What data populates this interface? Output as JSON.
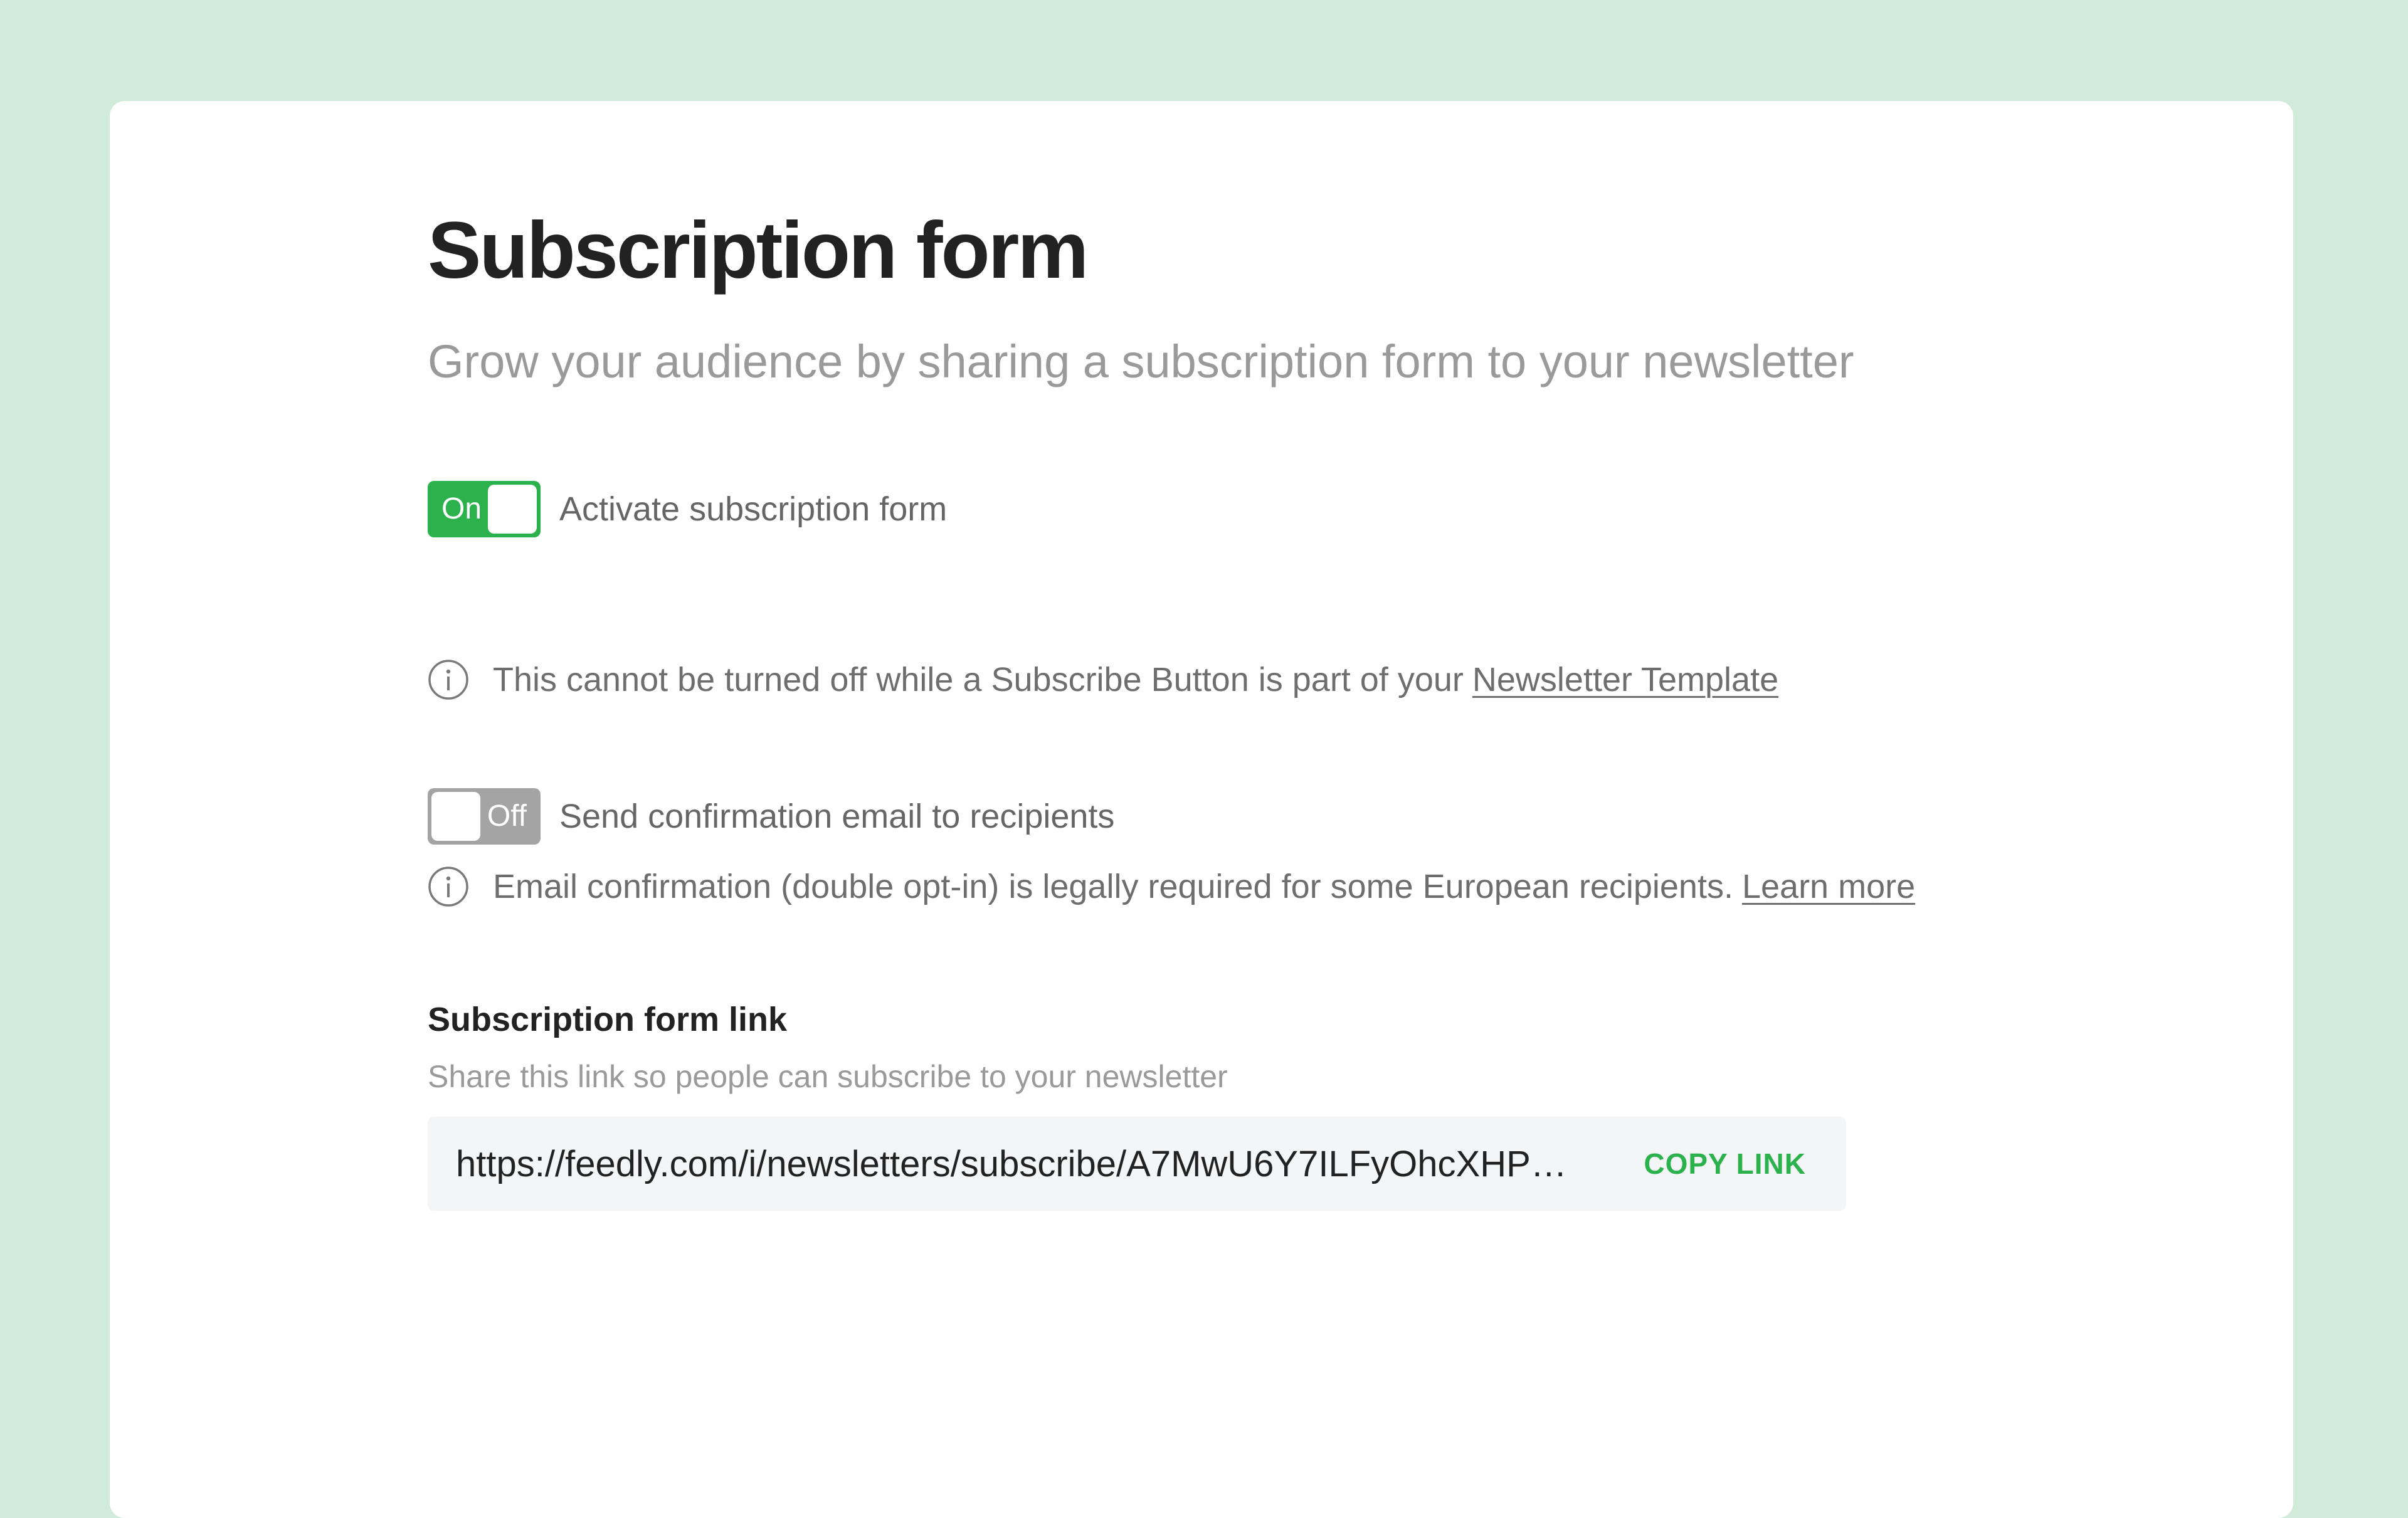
{
  "page": {
    "title": "Subscription form",
    "subtitle": "Grow your audience by sharing a subscription form to your newsletter"
  },
  "activate": {
    "state": "On",
    "label": "Activate subscription form",
    "info_text": "This cannot be turned off while a Subscribe Button is part of your",
    "info_link": "Newsletter Template"
  },
  "confirmation": {
    "state": "Off",
    "label": "Send confirmation email to recipients",
    "info_text": "Email confirmation (double opt-in) is legally required for some European recipients.",
    "info_link": "Learn more"
  },
  "link_section": {
    "heading": "Subscription form link",
    "description": "Share this link so people can subscribe to your newsletter",
    "url": "https://feedly.com/i/newsletters/subscribe/A7MwU6Y7ILFyOhcXHP…",
    "copy_label": "COPY LINK"
  },
  "colors": {
    "background": "#d1ebda",
    "accent_green": "#2bb24c",
    "toggle_off": "#a4a4a4"
  },
  "icons": {
    "info": "info-circle-icon"
  }
}
